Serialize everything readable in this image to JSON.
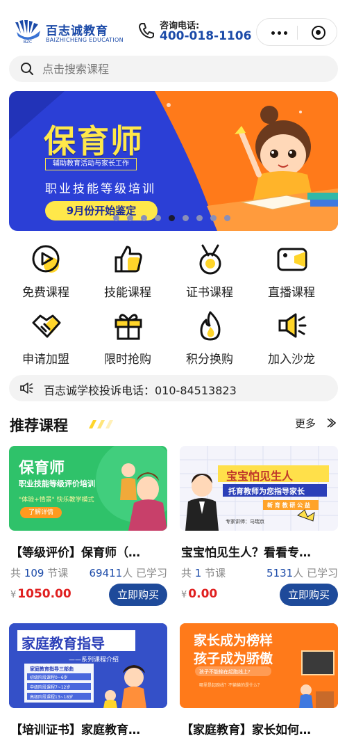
{
  "header": {
    "logo_cn": "百志诚教育",
    "logo_en": "BAIZHICHENG EDUCATION",
    "logo_mark": "BZC",
    "consult_label": "咨询电话:",
    "consult_number": "400-018-1106"
  },
  "search": {
    "placeholder": "点击搜索课程"
  },
  "banner": {
    "title": "保育师",
    "tag": "辅助教育活动与家长工作",
    "subtitle": "职业技能等级培训",
    "pill": "9月份开始鉴定",
    "slide_count": 9,
    "active_slide": 8,
    "colors": {
      "left": "#2b3fd6",
      "right": "#ff7a1a",
      "accent": "#ffe84a"
    }
  },
  "menu": [
    {
      "label": "免费课程",
      "icon": "play-circle-icon"
    },
    {
      "label": "技能课程",
      "icon": "thumbs-up-icon"
    },
    {
      "label": "证书课程",
      "icon": "medal-icon"
    },
    {
      "label": "直播课程",
      "icon": "video-camera-icon"
    },
    {
      "label": "申请加盟",
      "icon": "handshake-icon"
    },
    {
      "label": "限时抢购",
      "icon": "gift-icon"
    },
    {
      "label": "积分换购",
      "icon": "flame-icon"
    },
    {
      "label": "加入沙龙",
      "icon": "megaphone-icon"
    }
  ],
  "notice": {
    "text": "百志诚学校投诉电话：010-84513823"
  },
  "section": {
    "title": "推荐课程",
    "more": "更多"
  },
  "courses": [
    {
      "title": "【等级评价】保育师（…",
      "lessons_prefix": "共",
      "lessons": "109",
      "lessons_suffix": "节课",
      "learners": "69411",
      "learners_suffix": "人 已学习",
      "currency": "¥",
      "price": "1050.00",
      "buy": "立即购买",
      "thumb": {
        "t1": "保育师",
        "t2": "职业技能等级评价培训",
        "t3": "\"体验+情景\" 快乐教学模式",
        "t4": "了解详情"
      }
    },
    {
      "title": "宝宝怕见生人？看看专…",
      "lessons_prefix": "共",
      "lessons": "1",
      "lessons_suffix": "节课",
      "learners": "5131",
      "learners_suffix": "人 已学习",
      "currency": "¥",
      "price": "0.00",
      "buy": "立即购买",
      "thumb": {
        "t1": "宝宝怕见生人",
        "t2": "托育教师为您指导家长",
        "t3": "新 育 教 研 公 益",
        "t4": "专家讲师：马瑞京"
      }
    },
    {
      "title": "【培训证书】家庭教育…",
      "thumb": {
        "t1": "家庭教育指导",
        "t2": "——系列课程介绍",
        "t3": "家庭教育指导三部曲",
        "rows": [
          "初级阶段课程0~6岁",
          "中级阶段课程7~12岁",
          "高级阶段课程13~18岁"
        ]
      }
    },
    {
      "title": "【家庭教育】家长如何…",
      "thumb": {
        "t1": "家长成为榜样",
        "t2": "孩子成为骄傲",
        "t3": "孩子不能输在起跑线上?",
        "t4": "哪里是起跑线？不输输的是什么？"
      }
    }
  ]
}
